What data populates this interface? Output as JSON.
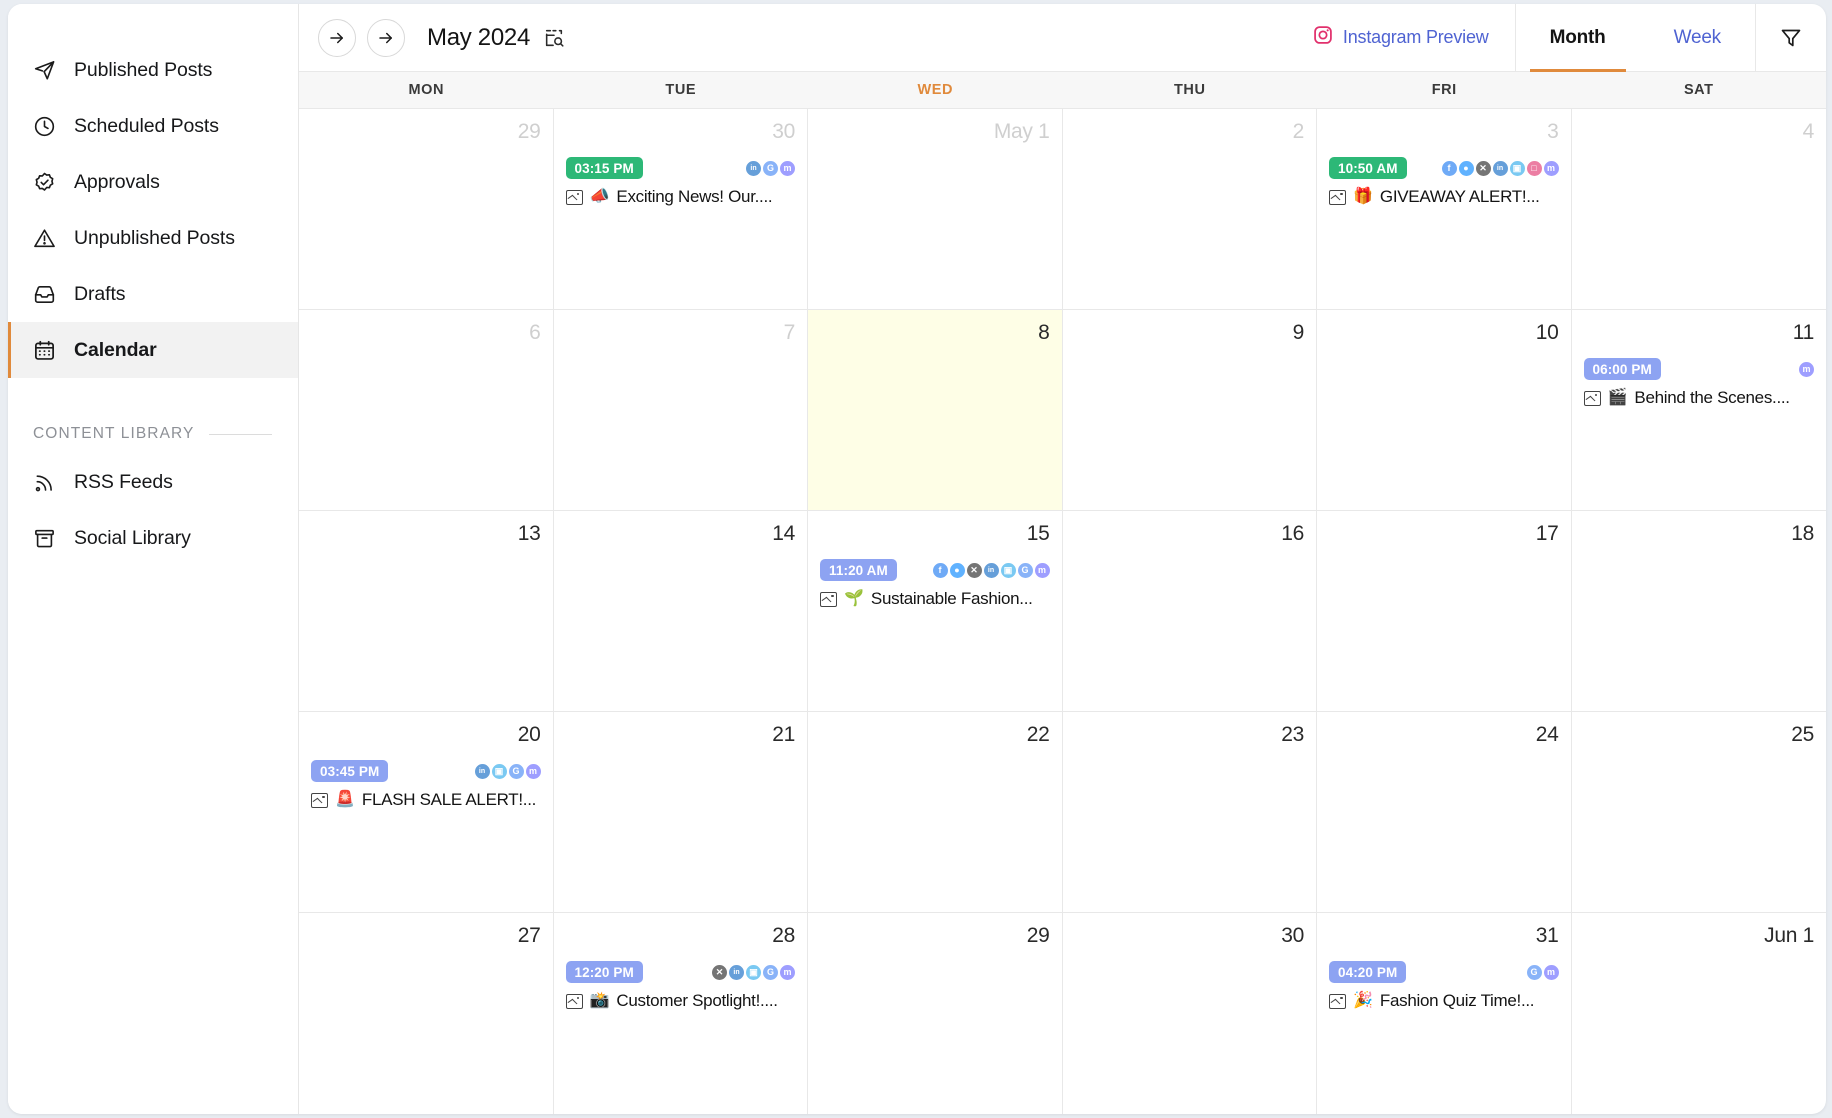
{
  "sidebar": {
    "items": [
      {
        "label": "Published Posts",
        "icon": "send-icon",
        "active": false
      },
      {
        "label": "Scheduled Posts",
        "icon": "clock-icon",
        "active": false
      },
      {
        "label": "Approvals",
        "icon": "check-badge-icon",
        "active": false
      },
      {
        "label": "Unpublished Posts",
        "icon": "warning-triangle-icon",
        "active": false
      },
      {
        "label": "Drafts",
        "icon": "inbox-icon",
        "active": false
      },
      {
        "label": "Calendar",
        "icon": "calendar-icon",
        "active": true
      }
    ],
    "section_label": "CONTENT LIBRARY",
    "library_items": [
      {
        "label": "RSS Feeds",
        "icon": "rss-icon"
      },
      {
        "label": "Social Library",
        "icon": "archive-icon"
      }
    ]
  },
  "topbar": {
    "prev_label": "previous",
    "next_label": "next",
    "month_title": "May 2024",
    "search_icon": "calendar-search-icon",
    "instagram_preview": "Instagram Preview",
    "instagram_icon": "instagram-icon",
    "tabs": [
      {
        "label": "Month",
        "active": true
      },
      {
        "label": "Week",
        "active": false
      }
    ],
    "filter_icon": "filter-icon",
    "accent_color": "#e08a3c",
    "link_color": "#4f63d2"
  },
  "calendar": {
    "day_headers": [
      {
        "label": "MON",
        "today": false
      },
      {
        "label": "TUE",
        "today": false
      },
      {
        "label": "WED",
        "today": true
      },
      {
        "label": "THU",
        "today": false
      },
      {
        "label": "FRI",
        "today": false
      },
      {
        "label": "SAT",
        "today": false
      }
    ],
    "today_highlight_color": "#fefee6",
    "weeks": [
      [
        {
          "day": "29",
          "muted": true,
          "today": false,
          "events": []
        },
        {
          "day": "30",
          "muted": true,
          "today": false,
          "events": [
            {
              "time": "03:15 PM",
              "badge_color": "green",
              "emoji": "📣",
              "title": "Exciting News! Our....",
              "socials": [
                "linkedin",
                "google",
                "mastodon"
              ]
            }
          ]
        },
        {
          "day": "May 1",
          "muted": true,
          "today": false,
          "events": []
        },
        {
          "day": "2",
          "muted": true,
          "today": false,
          "events": []
        },
        {
          "day": "3",
          "muted": true,
          "today": false,
          "events": [
            {
              "time": "10:50 AM",
              "badge_color": "green",
              "emoji": "🎁",
              "title": "GIVEAWAY ALERT!...",
              "socials": [
                "facebook",
                "messenger",
                "x",
                "linkedin",
                "telegram",
                "instagram",
                "mastodon"
              ]
            }
          ]
        },
        {
          "day": "4",
          "muted": true,
          "today": false,
          "events": []
        }
      ],
      [
        {
          "day": "6",
          "muted": true,
          "today": false,
          "events": []
        },
        {
          "day": "7",
          "muted": true,
          "today": false,
          "events": []
        },
        {
          "day": "8",
          "muted": false,
          "today": true,
          "events": []
        },
        {
          "day": "9",
          "muted": false,
          "today": false,
          "events": []
        },
        {
          "day": "10",
          "muted": false,
          "today": false,
          "events": []
        },
        {
          "day": "11",
          "muted": false,
          "today": false,
          "events": [
            {
              "time": "06:00 PM",
              "badge_color": "blue",
              "emoji": "🎬",
              "title": "Behind the Scenes....",
              "socials": [
                "mastodon"
              ]
            }
          ]
        }
      ],
      [
        {
          "day": "13",
          "muted": false,
          "today": false,
          "events": []
        },
        {
          "day": "14",
          "muted": false,
          "today": false,
          "events": []
        },
        {
          "day": "15",
          "muted": false,
          "today": false,
          "events": [
            {
              "time": "11:20 AM",
              "badge_color": "blue",
              "emoji": "🌱",
              "title": "Sustainable Fashion...",
              "socials": [
                "facebook",
                "messenger",
                "x",
                "linkedin",
                "telegram",
                "google",
                "mastodon"
              ]
            }
          ]
        },
        {
          "day": "16",
          "muted": false,
          "today": false,
          "events": []
        },
        {
          "day": "17",
          "muted": false,
          "today": false,
          "events": []
        },
        {
          "day": "18",
          "muted": false,
          "today": false,
          "events": []
        }
      ],
      [
        {
          "day": "20",
          "muted": false,
          "today": false,
          "events": [
            {
              "time": "03:45 PM",
              "badge_color": "blue",
              "emoji": "🚨",
              "title": "FLASH SALE ALERT!...",
              "socials": [
                "linkedin",
                "telegram",
                "google",
                "mastodon"
              ]
            }
          ]
        },
        {
          "day": "21",
          "muted": false,
          "today": false,
          "events": []
        },
        {
          "day": "22",
          "muted": false,
          "today": false,
          "events": []
        },
        {
          "day": "23",
          "muted": false,
          "today": false,
          "events": []
        },
        {
          "day": "24",
          "muted": false,
          "today": false,
          "events": []
        },
        {
          "day": "25",
          "muted": false,
          "today": false,
          "events": []
        }
      ],
      [
        {
          "day": "27",
          "muted": false,
          "today": false,
          "events": []
        },
        {
          "day": "28",
          "muted": false,
          "today": false,
          "events": [
            {
              "time": "12:20 PM",
              "badge_color": "blue",
              "emoji": "📸",
              "title": "Customer Spotlight!....",
              "socials": [
                "x",
                "linkedin",
                "telegram",
                "google",
                "mastodon"
              ]
            }
          ]
        },
        {
          "day": "29",
          "muted": false,
          "today": false,
          "events": []
        },
        {
          "day": "30",
          "muted": false,
          "today": false,
          "events": []
        },
        {
          "day": "31",
          "muted": false,
          "today": false,
          "events": [
            {
              "time": "04:20 PM",
              "badge_color": "blue",
              "emoji": "🎉",
              "title": "Fashion Quiz Time!...",
              "socials": [
                "google",
                "mastodon"
              ]
            }
          ]
        },
        {
          "day": "Jun 1",
          "muted": false,
          "today": false,
          "events": []
        }
      ]
    ],
    "social_colors": {
      "facebook": "#1877f2",
      "messenger": "#0084ff",
      "x": "#222222",
      "linkedin": "#0a66c2",
      "telegram": "#29a9eb",
      "google": "#4285f4",
      "instagram": "#e1306c",
      "mastodon": "#6364ff"
    },
    "social_glyphs": {
      "facebook": "f",
      "messenger": "●",
      "x": "✕",
      "linkedin": "in",
      "telegram": "▣",
      "google": "G",
      "instagram": "□",
      "mastodon": "m"
    }
  }
}
